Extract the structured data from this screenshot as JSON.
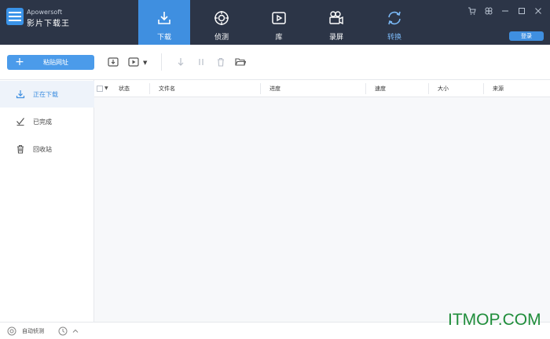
{
  "app": {
    "brand_top": "Apowersoft",
    "brand_name": "影片下载王"
  },
  "nav": [
    {
      "label": "下载",
      "icon": "download-icon",
      "active": true
    },
    {
      "label": "侦测",
      "icon": "detect-icon",
      "active": false
    },
    {
      "label": "库",
      "icon": "library-icon",
      "active": false
    },
    {
      "label": "录屏",
      "icon": "record-icon",
      "active": false
    },
    {
      "label": "转换",
      "icon": "convert-icon",
      "active": false
    }
  ],
  "window": {
    "login_label": "登录"
  },
  "toolbar": {
    "paste_label": "粘贴网址"
  },
  "sidebar": [
    {
      "label": "正在下载",
      "icon": "download-icon"
    },
    {
      "label": "已完成",
      "icon": "check-icon"
    },
    {
      "label": "回收站",
      "icon": "trash-icon"
    }
  ],
  "table": {
    "columns": [
      "状态",
      "文件名",
      "进度",
      "速度",
      "大小",
      "来源"
    ]
  },
  "footer": {
    "auto_detect": "自动侦测"
  },
  "watermark": "ITMOP.COM",
  "colors": {
    "header": "#2c3547",
    "accent": "#3f8fe0"
  }
}
